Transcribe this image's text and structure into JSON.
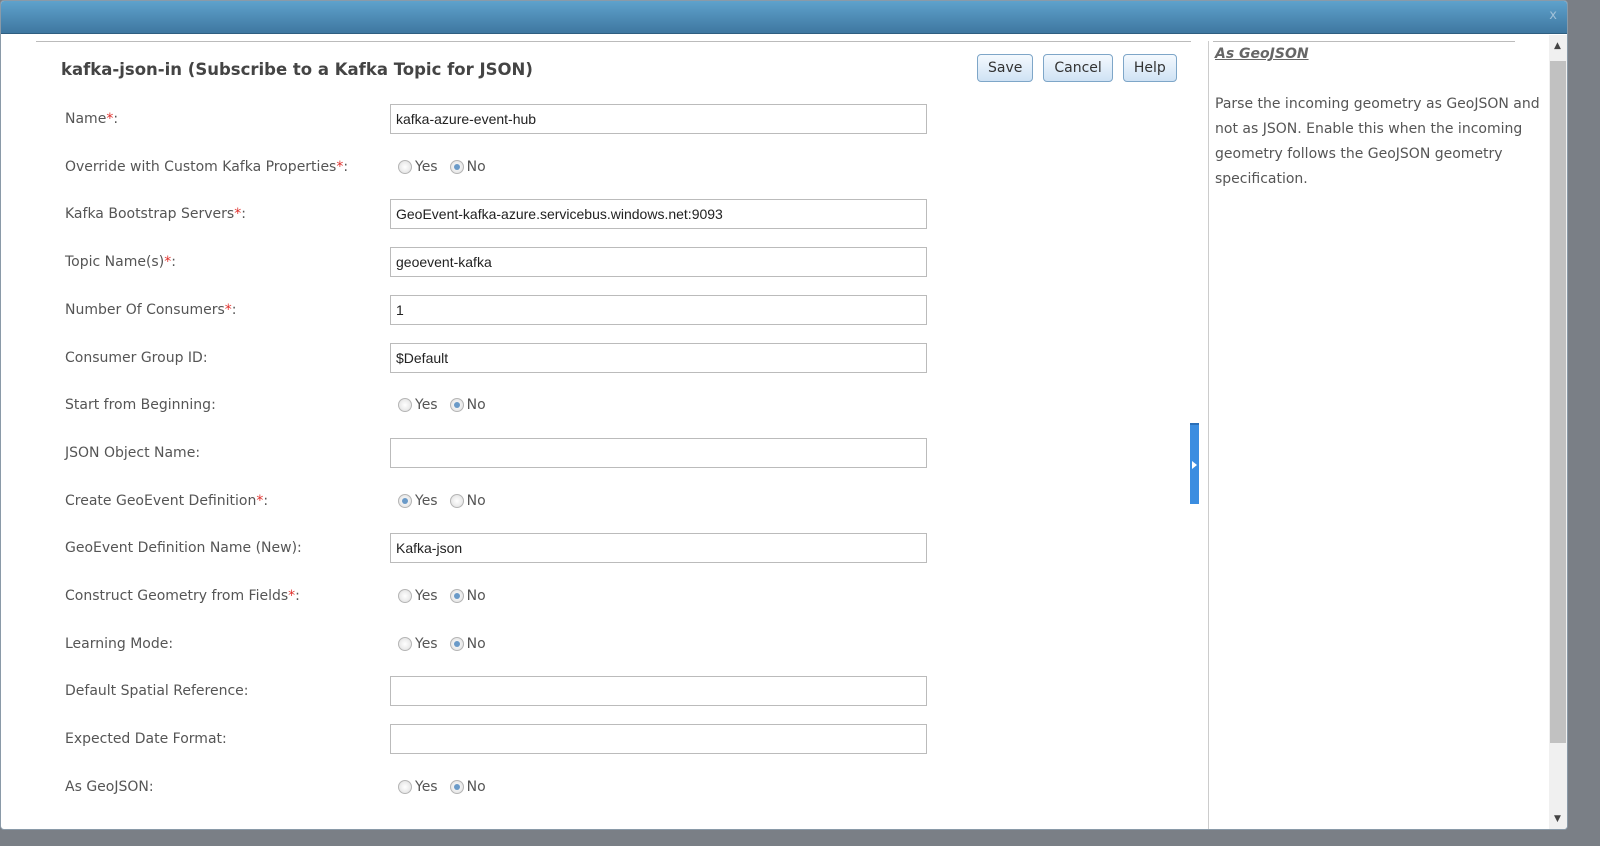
{
  "dialog": {
    "close_label": "x",
    "title": "kafka-json-in (Subscribe to a Kafka Topic for JSON)"
  },
  "buttons": {
    "save": "Save",
    "cancel": "Cancel",
    "help": "Help"
  },
  "radio_labels": {
    "yes": "Yes",
    "no": "No"
  },
  "fields": [
    {
      "label": "Name",
      "required": true,
      "type": "text",
      "value": "kafka-azure-event-hub"
    },
    {
      "label": "Override with Custom Kafka Properties",
      "required": true,
      "type": "radio",
      "value": "No"
    },
    {
      "label": "Kafka Bootstrap Servers",
      "required": true,
      "type": "text",
      "value": "GeoEvent-kafka-azure.servicebus.windows.net:9093"
    },
    {
      "label": "Topic Name(s)",
      "required": true,
      "type": "text",
      "value": "geoevent-kafka"
    },
    {
      "label": "Number Of Consumers",
      "required": true,
      "type": "text",
      "value": "1"
    },
    {
      "label": "Consumer Group ID",
      "required": false,
      "type": "text",
      "value": "$Default"
    },
    {
      "label": "Start from Beginning",
      "required": false,
      "type": "radio",
      "value": "No"
    },
    {
      "label": "JSON Object Name",
      "required": false,
      "type": "text",
      "value": ""
    },
    {
      "label": "Create GeoEvent Definition",
      "required": true,
      "type": "radio",
      "value": "Yes"
    },
    {
      "label": "GeoEvent Definition Name (New)",
      "required": false,
      "type": "text",
      "value": "Kafka-json"
    },
    {
      "label": "Construct Geometry from Fields",
      "required": true,
      "type": "radio",
      "value": "No"
    },
    {
      "label": "Learning Mode",
      "required": false,
      "type": "radio",
      "value": "No"
    },
    {
      "label": "Default Spatial Reference",
      "required": false,
      "type": "text",
      "value": ""
    },
    {
      "label": "Expected Date Format",
      "required": false,
      "type": "text",
      "value": ""
    },
    {
      "label": "As GeoJSON",
      "required": false,
      "type": "radio",
      "value": "No"
    }
  ],
  "help": {
    "title": "As GeoJSON",
    "text": "Parse the incoming geometry as GeoJSON and not as JSON. Enable this when the incoming geometry follows the GeoJSON geometry specification."
  }
}
